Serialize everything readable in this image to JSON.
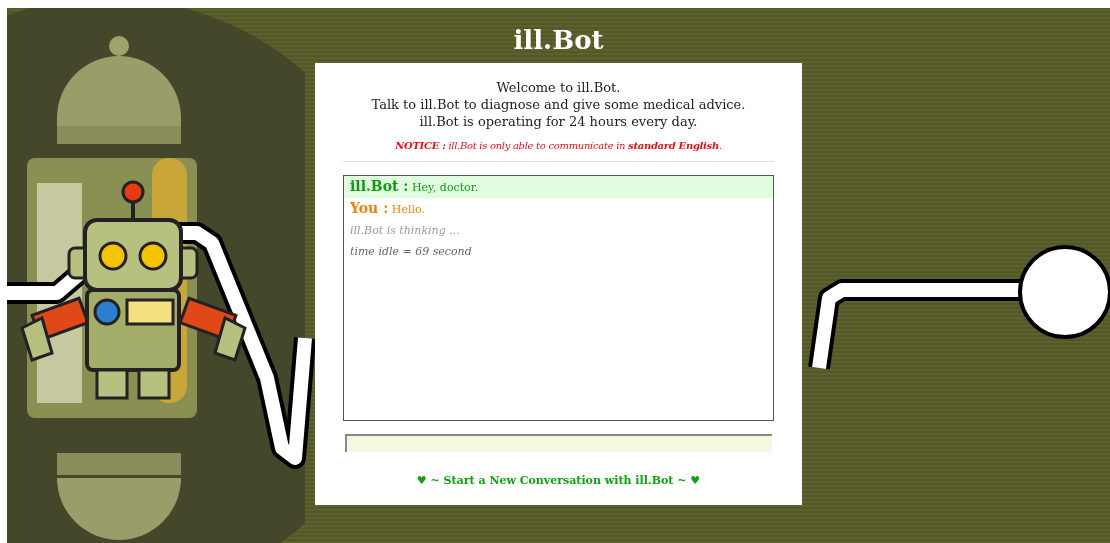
{
  "title": "ill.Bot",
  "intro": [
    "Welcome to ill.Bot.",
    "Talk to ill.Bot to diagnose and give some medical advice.",
    "ill.Bot is operating for 24 hours every day."
  ],
  "notice": "**NOTICE :** ill.Bot is only able to communicate in **standard English**.",
  "messages": [
    {
      "kind": "bot",
      "speaker": "ill.Bot :",
      "text": "Hey, doctor."
    },
    {
      "kind": "user",
      "speaker": "You :",
      "text": "Hello."
    },
    {
      "kind": "status",
      "text": "ill.Bot is thinking ..."
    },
    {
      "kind": "idle",
      "text": "time idle = 69 second"
    }
  ],
  "new_conversation_link": "♥ ~ Start a New Conversation with ill.Bot ~ ♥"
}
